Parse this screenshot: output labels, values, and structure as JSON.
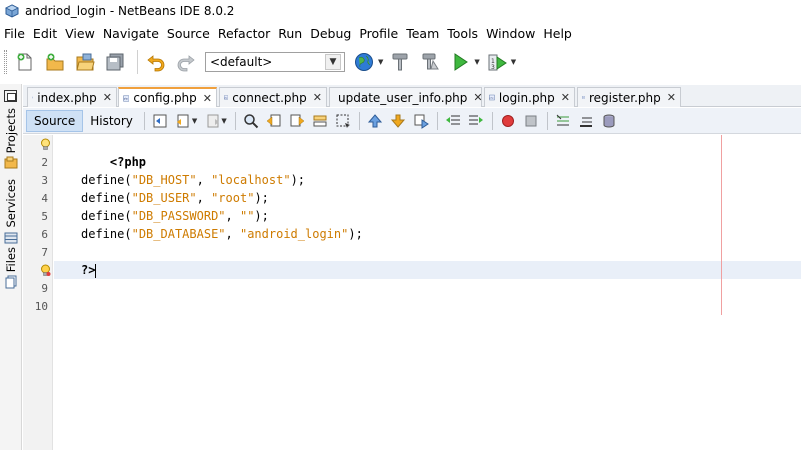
{
  "window": {
    "title": "andriod_login - NetBeans IDE 8.0.2"
  },
  "menu": [
    "File",
    "Edit",
    "View",
    "Navigate",
    "Source",
    "Refactor",
    "Run",
    "Debug",
    "Profile",
    "Team",
    "Tools",
    "Window",
    "Help"
  ],
  "toolbar": {
    "config_value": "<default>",
    "icons": [
      "new-file-icon",
      "new-project-icon",
      "open-project-icon",
      "save-all-icon",
      "undo-icon",
      "redo-icon",
      "browser-icon",
      "build-icon",
      "clean-build-icon",
      "run-icon",
      "debug-icon"
    ]
  },
  "side_tabs": [
    "Projects",
    "Services",
    "Files"
  ],
  "tabs": [
    {
      "label": "index.php",
      "active": false
    },
    {
      "label": "config.php",
      "active": true
    },
    {
      "label": "connect.php",
      "active": false
    },
    {
      "label": "update_user_info.php",
      "active": false
    },
    {
      "label": "login.php",
      "active": false
    },
    {
      "label": "register.php",
      "active": false
    }
  ],
  "editor_toolbar": {
    "source_label": "Source",
    "history_label": "History"
  },
  "line_numbers": [
    "1",
    "2",
    "3",
    "4",
    "5",
    "6",
    "7",
    "8",
    "9",
    "10"
  ],
  "code": {
    "line1": "<?php",
    "line3": {
      "fn": "define",
      "key": "\"DB_HOST\"",
      "value": "\"localhost\""
    },
    "line4": {
      "fn": "define",
      "key": "\"DB_USER\"",
      "value": "\"root\""
    },
    "line5": {
      "fn": "define",
      "key": "\"DB_PASSWORD\"",
      "value": "\"\""
    },
    "line6": {
      "fn": "define",
      "key": "\"DB_DATABASE\"",
      "value": "\"android_login\""
    },
    "line8": "?>"
  },
  "colors": {
    "string": "#ce7b00",
    "active_tab_accent": "#f0a03c",
    "current_line": "#e9eff8",
    "right_margin": "#f0a0a0"
  }
}
